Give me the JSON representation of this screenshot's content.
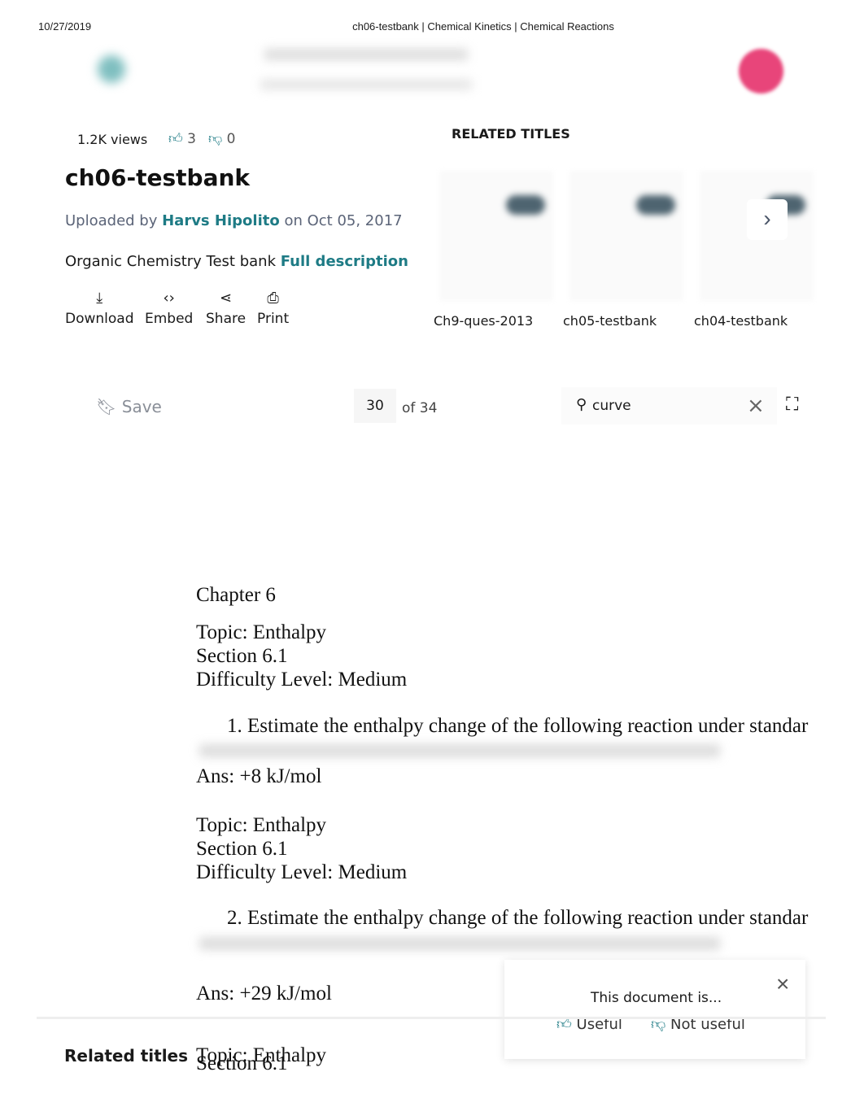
{
  "print_header": {
    "date": "10/27/2019",
    "title": "ch06-testbank | Chemical Kinetics | Chemical Reactions"
  },
  "colors": {
    "accent": "#1e7b85",
    "avatar": "#e8457a"
  },
  "doc": {
    "views": "1.2K views",
    "likes": "3",
    "dislikes": "0",
    "title": "ch06-testbank",
    "uploaded_prefix": "Uploaded by",
    "uploader": "Harvs Hipolito",
    "uploaded_suffix": "on Oct 05, 2017",
    "description": "Organic Chemistry Test bank",
    "full_description": "Full description"
  },
  "actions": [
    {
      "label": "Download",
      "icon": "download-icon"
    },
    {
      "label": "Embed",
      "icon": "code-icon"
    },
    {
      "label": "Share",
      "icon": "share-icon"
    },
    {
      "label": "Print",
      "icon": "print-icon"
    }
  ],
  "related": {
    "heading": "RELATED TITLES",
    "items": [
      "Ch9-ques-2013",
      "ch05-testbank",
      "ch04-testbank"
    ]
  },
  "toolbar": {
    "save": "Save",
    "page": "30",
    "of": "of 34",
    "search_value": "curve"
  },
  "page": {
    "chapter": "Chapter 6",
    "blocks": [
      {
        "topic": "Topic:  Enthalpy",
        "section": "Section 6.1",
        "difficulty": "Difficulty  Level:  Medium",
        "question": "1.   Estimate the enthalpy change of the following reaction under standar",
        "answer": "Ans:  +8  kJ/mol"
      },
      {
        "topic": "Topic:  Enthalpy",
        "section": "Section 6.1",
        "difficulty": "Difficulty  Level:  Medium",
        "question": "2.   Estimate the enthalpy change of the following reaction under standar",
        "answer": "Ans:  +29  kJ/mol"
      }
    ],
    "topic3": "Topic:  Enthalpy",
    "section3": "Section 6.1"
  },
  "feedback": {
    "prompt": "This document is...",
    "useful": "Useful",
    "not_useful": "Not useful"
  },
  "footer": {
    "related_titles": "Related titles"
  }
}
